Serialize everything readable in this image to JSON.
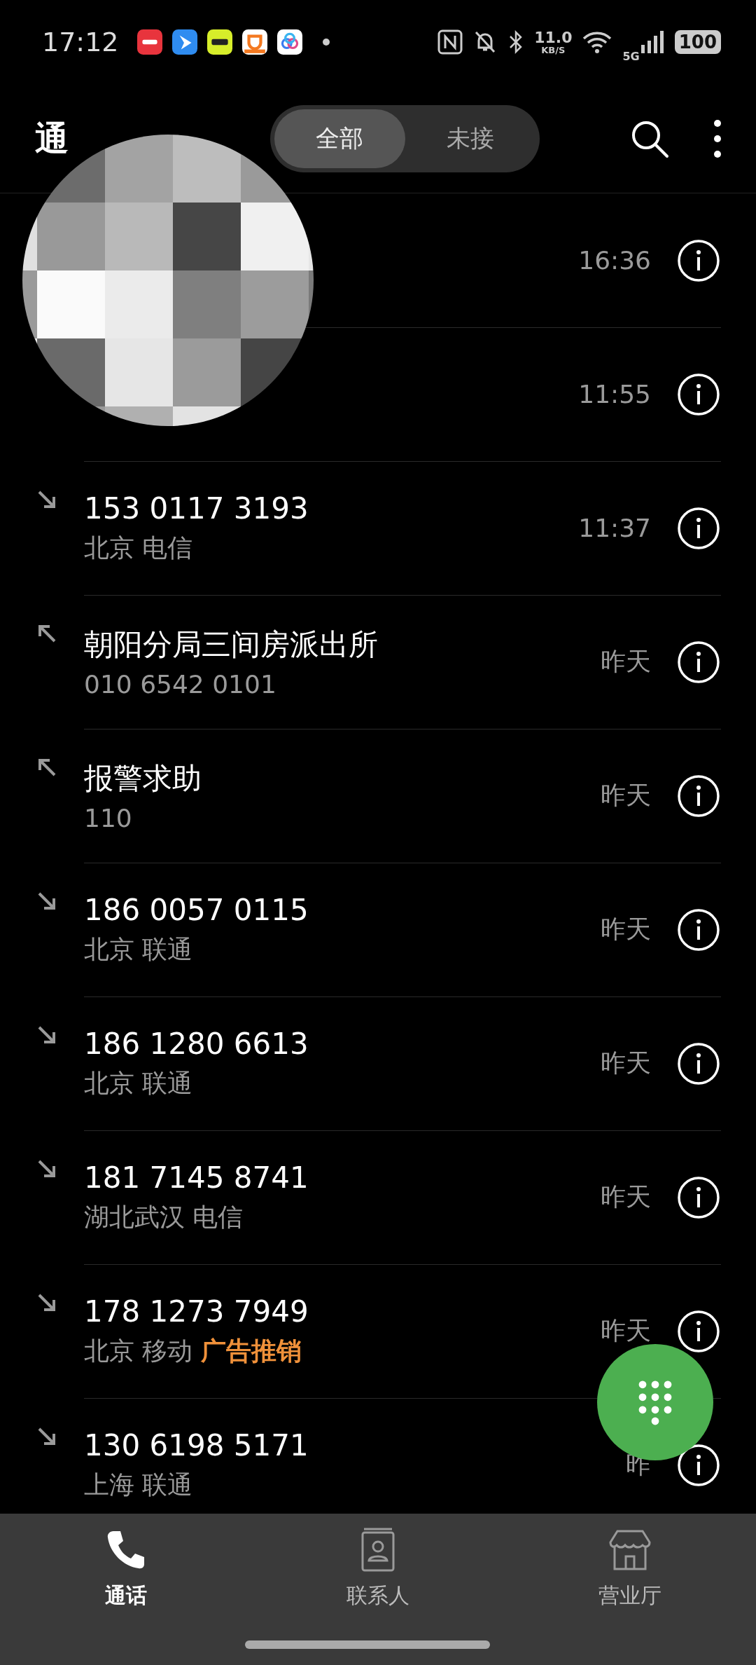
{
  "status_bar": {
    "time": "17:12",
    "net_speed": "11.0",
    "net_unit": "KB/S",
    "network": "5G",
    "battery": "100"
  },
  "header": {
    "title": "通",
    "tabs": [
      {
        "label": "全部",
        "selected": true
      },
      {
        "label": "未接",
        "selected": false
      }
    ]
  },
  "calls": [
    {
      "time": "16:36"
    },
    {
      "time": "11:55"
    },
    {
      "kind": "incoming",
      "name": "153 0117 3193",
      "detail": "北京 电信",
      "time": "11:37"
    },
    {
      "kind": "outgoing",
      "name": "朝阳分局三间房派出所",
      "detail": "010 6542 0101",
      "time": "昨天"
    },
    {
      "kind": "outgoing",
      "name": "报警求助",
      "detail": "110",
      "time": "昨天"
    },
    {
      "kind": "incoming",
      "name": "186 0057 0115",
      "detail": "北京 联通",
      "time": "昨天"
    },
    {
      "kind": "incoming",
      "name": "186 1280 6613",
      "detail": "北京 联通",
      "time": "昨天"
    },
    {
      "kind": "incoming",
      "name": "181 7145 8741",
      "detail": "湖北武汉 电信",
      "time": "昨天"
    },
    {
      "kind": "incoming",
      "name": "178 1273 7949",
      "detail": "北京 移动",
      "tag": "广告推销",
      "time": "昨天"
    },
    {
      "kind": "incoming",
      "name": "130 6198 5171",
      "detail": "上海 联通",
      "time": "昨"
    }
  ],
  "nav": [
    {
      "kind": "phone",
      "label": "通话",
      "selected": true
    },
    {
      "kind": "contacts",
      "label": "联系人",
      "selected": false
    },
    {
      "kind": "store",
      "label": "营业厅",
      "selected": false
    }
  ]
}
